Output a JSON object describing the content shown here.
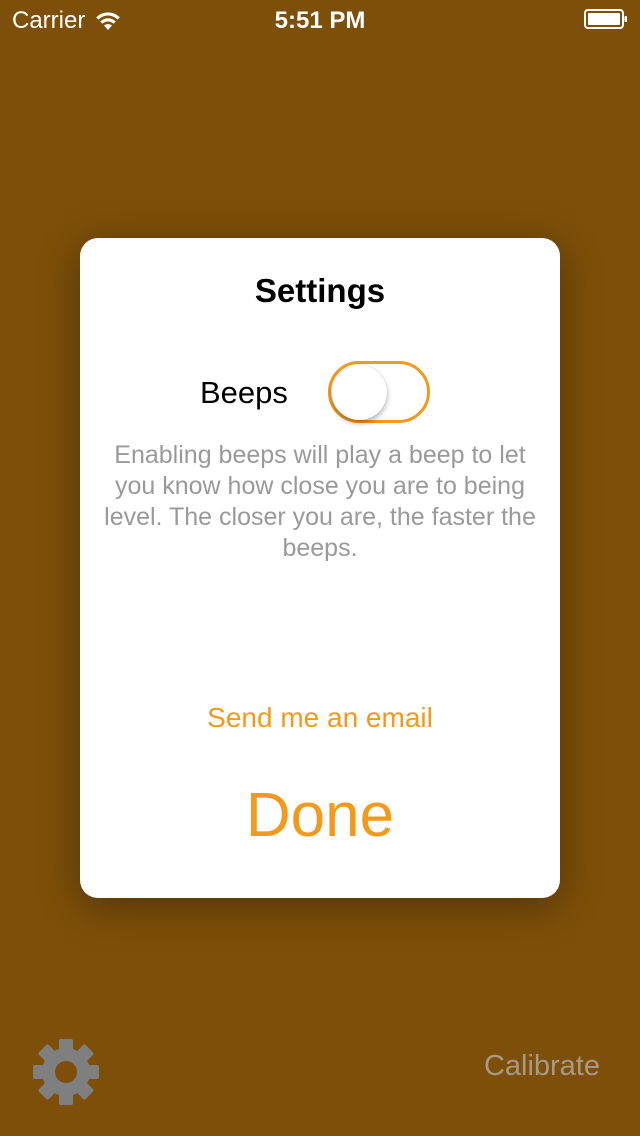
{
  "status_bar": {
    "carrier": "Carrier",
    "time": "5:51 PM",
    "icons": [
      "wifi-icon",
      "battery-icon"
    ]
  },
  "modal": {
    "title": "Settings",
    "beeps": {
      "label": "Beeps",
      "enabled": false
    },
    "description": "Enabling beeps will play a beep to let you know how close you are to being level. The closer you are, the faster the beeps.",
    "email_link": "Send me an email",
    "done_label": "Done"
  },
  "toolbar": {
    "settings_icon": "gear-icon",
    "calibrate_label": "Calibrate"
  },
  "colors": {
    "background": "#7d4f09",
    "accent": "#f39a1d",
    "description_text": "#9a9a9a",
    "calibrate_text": "#a89a86",
    "gear": "#7f7f7f"
  }
}
